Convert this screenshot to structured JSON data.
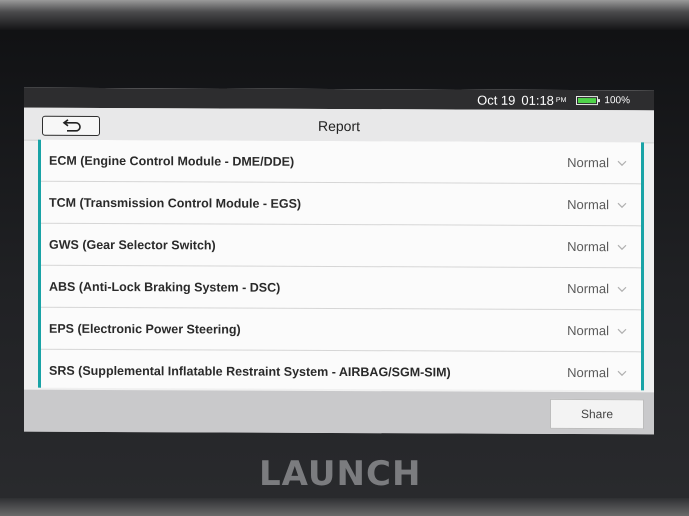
{
  "status_bar": {
    "date": "Oct 19",
    "time": "01:18",
    "ampm": "PM",
    "battery_percent": "100%",
    "battery_level": 1.0,
    "battery_color": "#4fd34a"
  },
  "header": {
    "title": "Report",
    "back_icon": "back-arrow-icon"
  },
  "modules": [
    {
      "label": "ECM (Engine Control Module - DME/DDE)",
      "status": "Normal"
    },
    {
      "label": "TCM (Transmission Control Module - EGS)",
      "status": "Normal"
    },
    {
      "label": "GWS (Gear Selector Switch)",
      "status": "Normal"
    },
    {
      "label": "ABS (Anti-Lock Braking System - DSC)",
      "status": "Normal"
    },
    {
      "label": "EPS (Electronic Power Steering)",
      "status": "Normal"
    },
    {
      "label": "SRS (Supplemental Inflatable Restraint System - AIRBAG/SGM-SIM)",
      "status": "Normal"
    }
  ],
  "footer": {
    "share_label": "Share"
  },
  "device": {
    "brand": "LAUNCH"
  },
  "colors": {
    "accent": "#19a3a6",
    "status_bar_bg": "#2d2d2f"
  }
}
